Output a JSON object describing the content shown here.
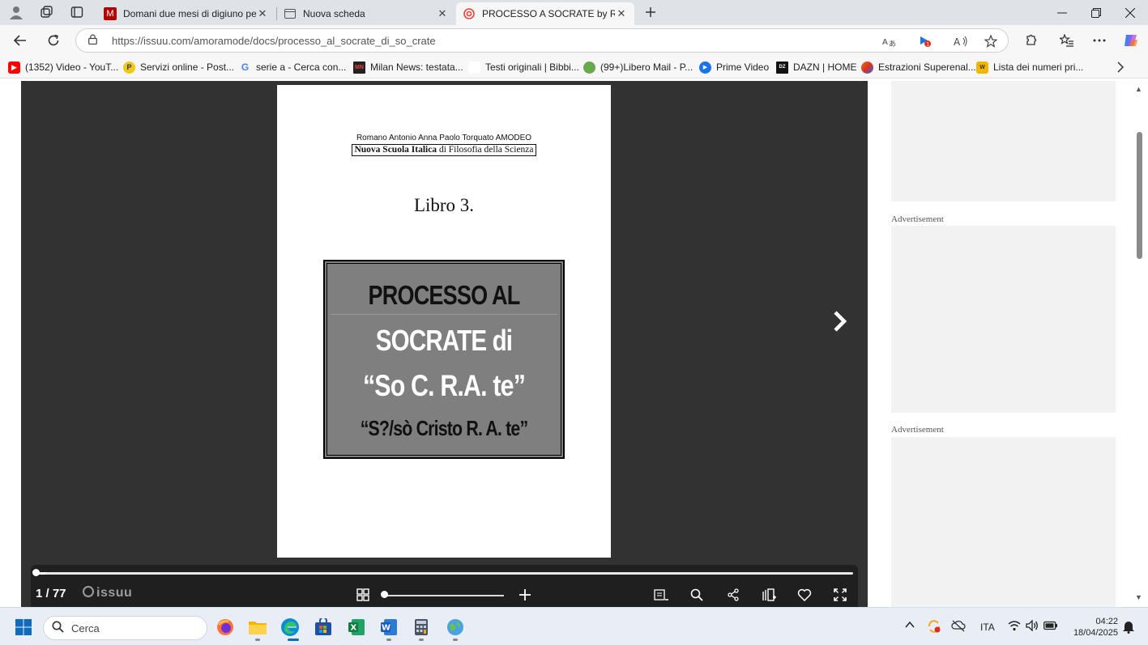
{
  "browser": {
    "tabs": [
      {
        "title": "Domani due mesi di digiuno per C",
        "icon": "news-icon",
        "active": false
      },
      {
        "title": "Nuova scheda",
        "icon": "new-tab-page-icon",
        "active": false
      },
      {
        "title": "PROCESSO A SOCRATE by Roman",
        "icon": "issuu-icon",
        "active": true
      }
    ],
    "url": "https://issuu.com/amoramode/docs/processo_al_socrate_di_so_crate",
    "bookmarks": [
      {
        "label": "(1352) Video - YouT...",
        "color": "#ff0000"
      },
      {
        "label": "Servizi online - Post...",
        "color": "#f2c811"
      },
      {
        "label": "serie a - Cerca con...",
        "color": "#4285f4"
      },
      {
        "label": "Milan News: testata...",
        "color": "#b00000"
      },
      {
        "label": "Testi originali | Bibbi...",
        "color": "#ffffff"
      },
      {
        "label": "(99+)Libero Mail - P...",
        "color": "#6aa84f"
      },
      {
        "label": "Prime Video",
        "color": "#1a73e8"
      },
      {
        "label": "DAZN | HOME",
        "color": "#111111"
      },
      {
        "label": "Estrazioni Superenal...",
        "color": "#e8710a"
      },
      {
        "label": "Lista dei numeri pri...",
        "color": "#f2b600"
      }
    ]
  },
  "document": {
    "author": "Romano Antonio Anna Paolo Torquato AMODEO",
    "school_bold": "Nuova Scuola Italica",
    "school_rest": " di Filosofia della Scienza",
    "book": "Libro 3.",
    "cover_lines": [
      "PROCESSO AL",
      "SOCRATE  di",
      "“So C. R.A. te”",
      "“S?/sò Cristo R. A. te”"
    ]
  },
  "viewer": {
    "page_indicator": "1 / 77",
    "brand": "issuu",
    "progress_fraction": 0.013
  },
  "ads": {
    "label": "Advertisement"
  },
  "taskbar": {
    "search_placeholder": "Cerca",
    "language": "ITA",
    "time": "04:22",
    "date": "18/04/2025"
  },
  "colors": {
    "viewer_bg": "#323232",
    "controls_bg": "#1f1f1f",
    "cover_bg": "#7f7f7f"
  }
}
